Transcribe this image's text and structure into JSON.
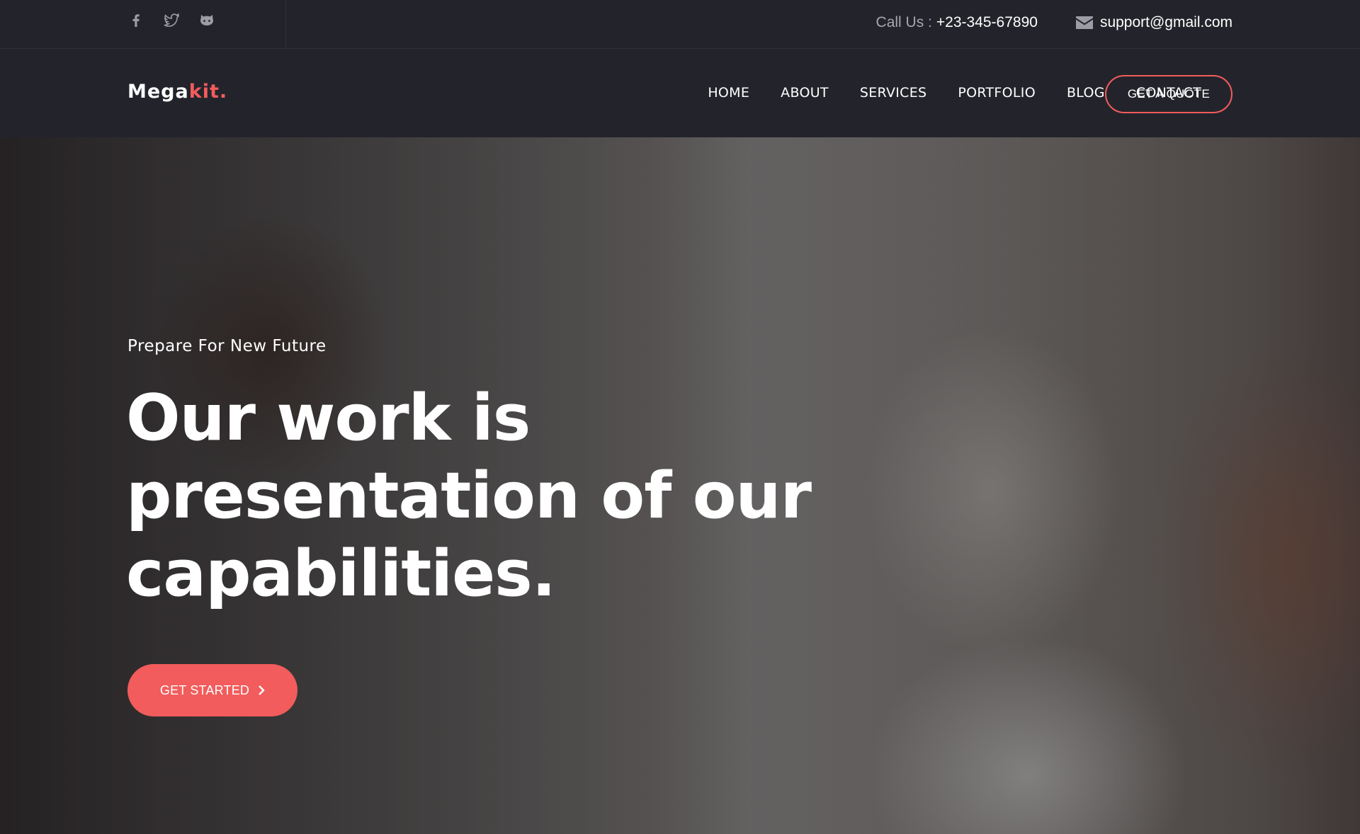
{
  "topbar": {
    "social_icons": [
      "facebook-icon",
      "twitter-icon",
      "github-icon"
    ],
    "call_label": "Call Us :",
    "phone": "+23-345-67890",
    "email": "support@gmail.com"
  },
  "brand": {
    "part1": "Mega",
    "part2": "kit."
  },
  "nav": {
    "items": [
      "HOME",
      "ABOUT",
      "SERVICES",
      "PORTFOLIO",
      "BLOG",
      "CONTACT"
    ],
    "cta": "GET A QUOTE"
  },
  "hero": {
    "tagline": "Prepare For New Future",
    "headline": "Our work is presentation of our capabilities.",
    "button": "GET STARTED"
  },
  "colors": {
    "accent": "#f25c5c",
    "background": "#23242b",
    "text": "#ffffff"
  }
}
